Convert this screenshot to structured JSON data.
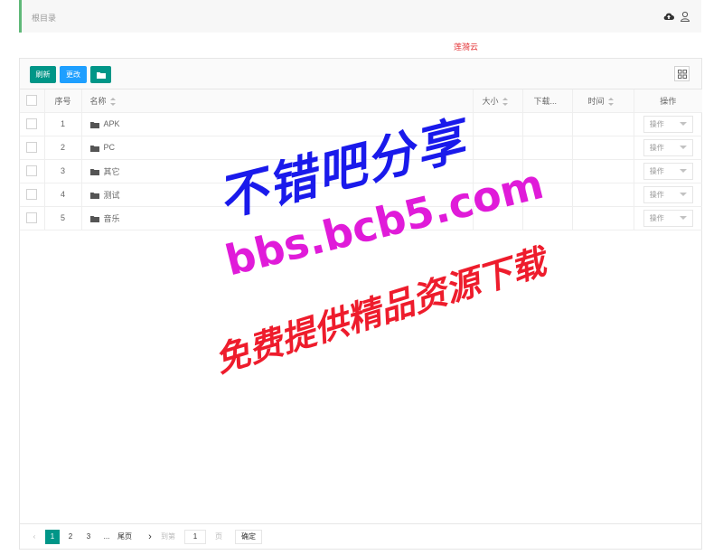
{
  "breadcrumb": {
    "root_label": "根目录"
  },
  "site": {
    "name": "莲漪云"
  },
  "toolbar": {
    "refresh_label": "刷新",
    "change_label": "更改"
  },
  "table": {
    "headers": {
      "index": "序号",
      "name": "名称",
      "size": "大小",
      "downloads": "下载...",
      "time": "时间",
      "actions": "操作"
    },
    "rows": [
      {
        "index": "1",
        "name": "APK",
        "action": "操作"
      },
      {
        "index": "2",
        "name": "PC",
        "action": "操作"
      },
      {
        "index": "3",
        "name": "其它",
        "action": "操作"
      },
      {
        "index": "4",
        "name": "测试",
        "action": "操作"
      },
      {
        "index": "5",
        "name": "音乐",
        "action": "操作"
      }
    ]
  },
  "pager": {
    "prev": "‹",
    "pages": [
      "1",
      "2",
      "3"
    ],
    "ellipsis": "...",
    "last_label": "尾页",
    "next": "›",
    "goto_label": "到第",
    "goto_value": "1",
    "page_unit": "页",
    "confirm_label": "确定"
  },
  "watermark": {
    "line1": "不错吧分享",
    "line2": "bbs.bcb5.com",
    "line3": "免费提供精品资源下载"
  },
  "icons": [
    "cloud-upload-icon",
    "user-icon",
    "folder-icon",
    "grid-icon",
    "sort-icon",
    "dropdown-icon"
  ],
  "colors": {
    "primary": "#009688",
    "info": "#1e9fff",
    "accent_border": "#5fb878",
    "site_name": "#e4393c"
  }
}
